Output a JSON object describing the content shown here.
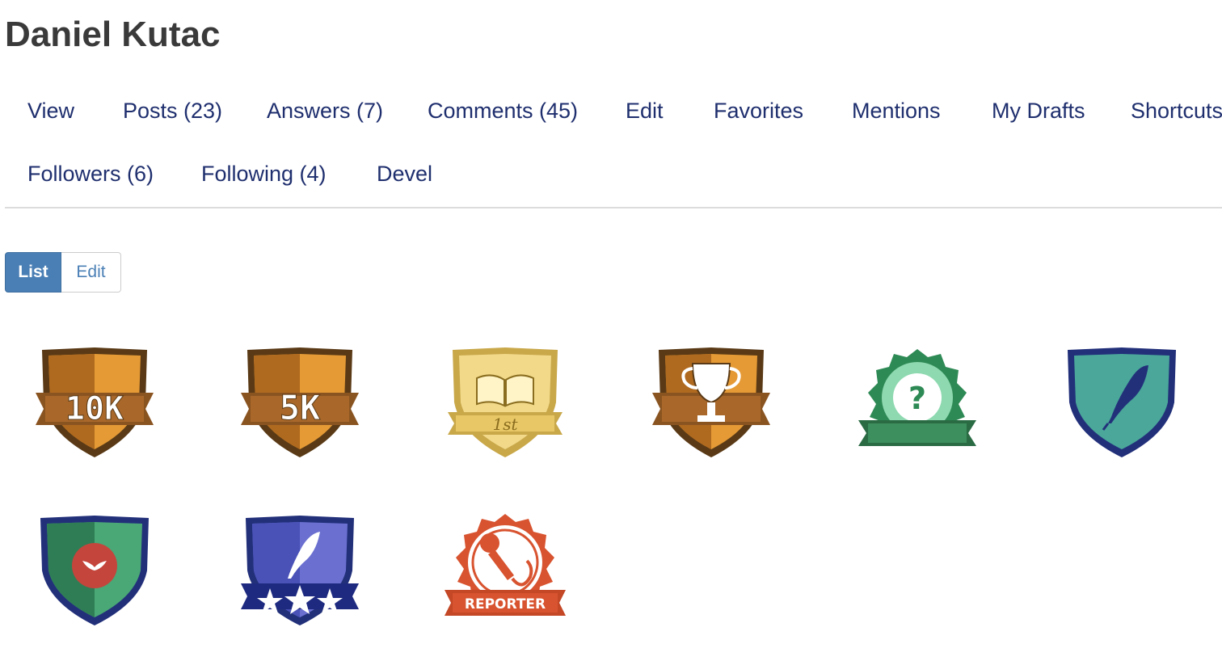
{
  "profile": {
    "name": "Daniel Kutac"
  },
  "tabs": {
    "row1": [
      "View",
      "Posts (23)",
      "Answers (7)",
      "Comments (45)",
      "Edit",
      "Favorites",
      "Mentions",
      "My Drafts",
      "Shortcuts"
    ],
    "row2": [
      "Followers (6)",
      "Following (4)",
      "Devel"
    ]
  },
  "view_toggle": {
    "list_label": "List",
    "edit_label": "Edit",
    "active": "List"
  },
  "badges": [
    {
      "name": "10k-badge",
      "text": "10K"
    },
    {
      "name": "5k-badge",
      "text": "5K"
    },
    {
      "name": "first-book-badge",
      "text": "1st"
    },
    {
      "name": "trophy-badge"
    },
    {
      "name": "question-badge"
    },
    {
      "name": "feather-shield-badge"
    },
    {
      "name": "red-emblem-shield-badge"
    },
    {
      "name": "feather-stars-badge"
    },
    {
      "name": "reporter-badge",
      "text": "REPORTER"
    }
  ],
  "colors": {
    "link": "#1f2f6e",
    "title": "#3a3a3a",
    "button_active": "#4a7fb5"
  }
}
